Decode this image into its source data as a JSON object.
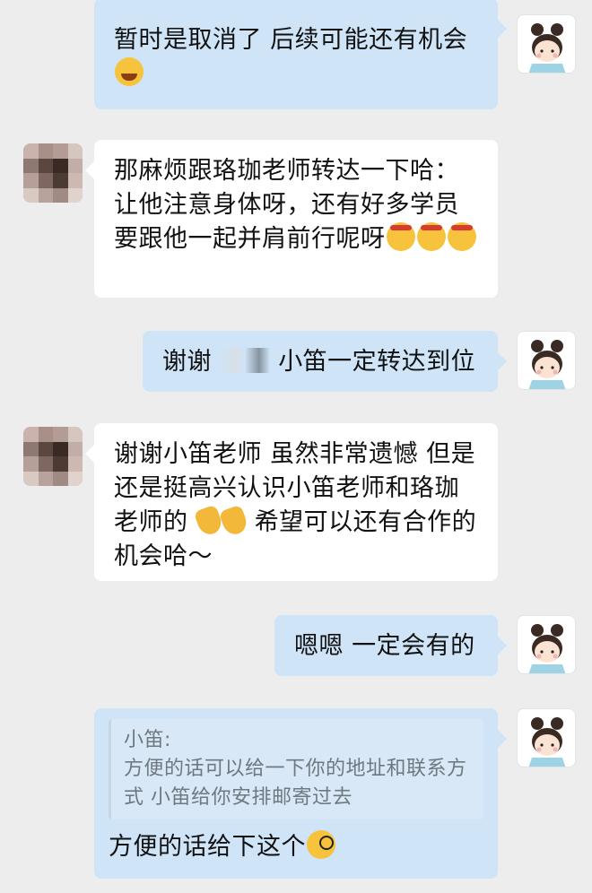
{
  "messages": [
    {
      "from": "me",
      "text": "暂时是取消了 后续可能还有机会",
      "emoji": "laugh-cry"
    },
    {
      "from": "them",
      "text": "那麻烦跟珞珈老师转达一下哈：让他注意身体呀，还有好多学员要跟他一起并肩前行呢呀",
      "emoji": "shushing x3"
    },
    {
      "from": "me",
      "text_before": "谢谢",
      "text_after": "小笛一定转达到位"
    },
    {
      "from": "them",
      "text_before": "谢谢小笛老师 虽然非常遗憾 但是还是挺高兴认识小笛老师和珞珈老师的",
      "emoji": "folded-hands x2",
      "text_after": "希望可以还有合作的机会哈～"
    },
    {
      "from": "me",
      "text": "嗯嗯 一定会有的"
    },
    {
      "from": "me",
      "quote_author": "小笛:",
      "quote_text": "方便的话可以给一下你的地址和联系方式 小笛给你安排邮寄过去",
      "text": "方便的话给下这个",
      "emoji": "monocle"
    }
  ],
  "colors": {
    "background": "#ededed",
    "my_bubble": "#cfe4f7",
    "their_bubble": "#ffffff"
  }
}
